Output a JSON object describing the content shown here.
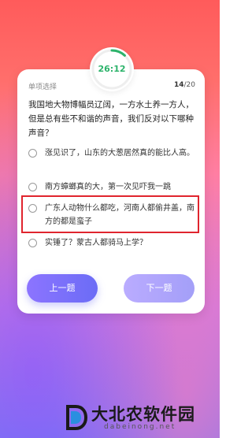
{
  "timer": {
    "text": "26:12",
    "accent": "#2db36b",
    "progress_fraction": 0.12
  },
  "card": {
    "question_type": "单项选择",
    "question_current": "14",
    "question_total": "/20",
    "question_text": "我国地大物博幅员辽阔，一方水土养一方人，但是总有些不和谐的声音，我们反对以下哪种声音？"
  },
  "options": [
    {
      "text": "涨见识了，山东的大葱居然真的能比人高。"
    },
    {
      "text": "南方蟑螂真的大，第一次见吓我一跳"
    },
    {
      "text": "广东人动物什么都吃，河南人都偷井盖，南方的都是蛮子"
    },
    {
      "text": "实锤了？蒙古人都骑马上学？"
    }
  ],
  "buttons": {
    "prev": "上一题",
    "next": "下一题"
  },
  "watermark": {
    "title": "大北农软件园",
    "url": "dabeinong.net"
  },
  "colors": {
    "highlight": "#e0252e",
    "button_prev": "#7a70f8",
    "button_next": "#aaa1fa"
  }
}
